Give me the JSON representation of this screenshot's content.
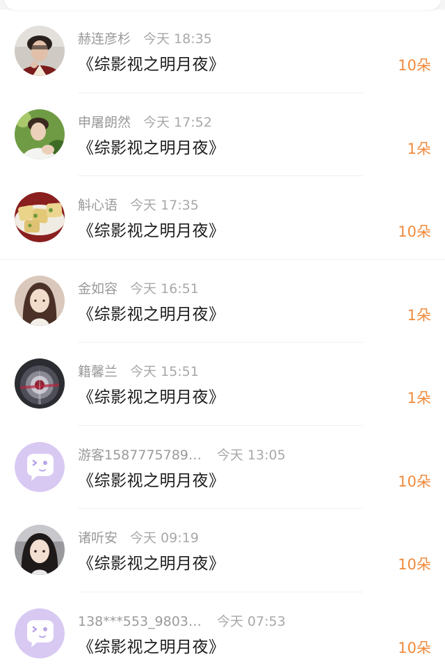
{
  "rows": [
    {
      "name": "赫连彦杉",
      "time": "今天 18:35",
      "title": "《综影视之明月夜》",
      "gift": "10朵",
      "avatar": "photo-boy-curly"
    },
    {
      "name": "申屠朗然",
      "time": "今天 17:52",
      "title": "《综影视之明月夜》",
      "gift": "1朵",
      "avatar": "photo-boy-outdoor"
    },
    {
      "name": "斛心语",
      "time": "今天 17:35",
      "title": "《综影视之明月夜》",
      "gift": "10朵",
      "avatar": "photo-food"
    },
    {
      "name": "金如容",
      "time": "今天 16:51",
      "title": "《综影视之明月夜》",
      "gift": "1朵",
      "avatar": "photo-girl"
    },
    {
      "name": "籍馨兰",
      "time": "今天 15:51",
      "title": "《综影视之明月夜》",
      "gift": "1朵",
      "avatar": "photo-abstract"
    },
    {
      "name": "游客1587775789…",
      "time": "今天 13:05",
      "title": "《综影视之明月夜》",
      "gift": "10朵",
      "avatar": "default-chat-bubble-avatar"
    },
    {
      "name": "诸听安",
      "time": "今天 09:19",
      "title": "《综影视之明月夜》",
      "gift": "10朵",
      "avatar": "photo-girl-long-hair"
    },
    {
      "name": "138***553_9803…",
      "time": "今天 07:53",
      "title": "《综影视之明月夜》",
      "gift": "10朵",
      "avatar": "default-chat-bubble-avatar"
    }
  ],
  "colors": {
    "accent": "#f08a3c",
    "default_avatar_bg": "#d8c9f3"
  }
}
